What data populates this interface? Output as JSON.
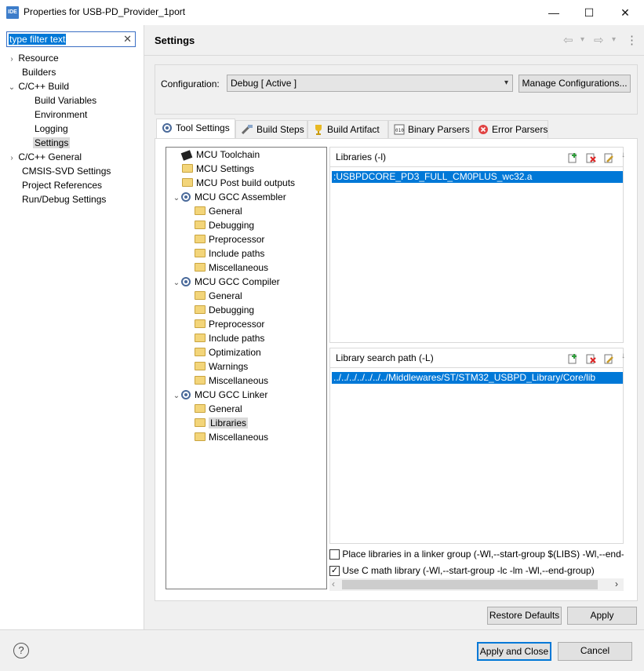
{
  "window": {
    "app_icon_text": "IDE",
    "title": "Properties for USB-PD_Provider_1port",
    "minimize": "—",
    "maximize": "☐",
    "close": "✕"
  },
  "filter": {
    "value": "type filter text",
    "clear": "✕"
  },
  "nav": {
    "items": [
      {
        "label": "Resource",
        "chevron": "›"
      },
      {
        "label": "Builders"
      },
      {
        "label": "C/C++ Build",
        "chevron": "⌄"
      },
      {
        "label": "Build Variables"
      },
      {
        "label": "Environment"
      },
      {
        "label": "Logging"
      },
      {
        "label": "Settings"
      },
      {
        "label": "C/C++ General",
        "chevron": "›"
      },
      {
        "label": "CMSIS-SVD Settings"
      },
      {
        "label": "Project References"
      },
      {
        "label": "Run/Debug Settings"
      }
    ]
  },
  "header": {
    "title": "Settings",
    "back": "⇦",
    "forward": "⇨",
    "dropdown": "▾",
    "menu": "⋮"
  },
  "config": {
    "label": "Configuration:",
    "value": "Debug  [ Active ]",
    "manage_button": "Manage Configurations..."
  },
  "tabs": [
    {
      "label": "Tool Settings",
      "icon": "tool-settings-icon"
    },
    {
      "label": "Build Steps",
      "icon": "build-steps-icon"
    },
    {
      "label": "Build Artifact",
      "icon": "trophy-icon"
    },
    {
      "label": "Binary Parsers",
      "icon": "binary-icon"
    },
    {
      "label": "Error Parsers",
      "icon": "error-icon"
    }
  ],
  "tree": {
    "items": [
      {
        "label": "MCU Toolchain"
      },
      {
        "label": "MCU Settings"
      },
      {
        "label": "MCU Post build outputs"
      },
      {
        "label": "MCU GCC Assembler",
        "chevron": "⌄"
      },
      {
        "label": "General"
      },
      {
        "label": "Debugging"
      },
      {
        "label": "Preprocessor"
      },
      {
        "label": "Include paths"
      },
      {
        "label": "Miscellaneous"
      },
      {
        "label": "MCU GCC Compiler",
        "chevron": "⌄"
      },
      {
        "label": "General"
      },
      {
        "label": "Debugging"
      },
      {
        "label": "Preprocessor"
      },
      {
        "label": "Include paths"
      },
      {
        "label": "Optimization"
      },
      {
        "label": "Warnings"
      },
      {
        "label": "Miscellaneous"
      },
      {
        "label": "MCU GCC Linker",
        "chevron": "⌄"
      },
      {
        "label": "General"
      },
      {
        "label": "Libraries"
      },
      {
        "label": "Miscellaneous"
      }
    ]
  },
  "libraries": {
    "title": "Libraries (-l)",
    "items": [
      ":USBPDCORE_PD3_FULL_CM0PLUS_wc32.a"
    ]
  },
  "search_path": {
    "title": "Library search path (-L)",
    "items": [
      "../../../../../../../Middlewares/ST/STM32_USBPD_Library/Core/lib"
    ]
  },
  "options": {
    "group_label": "Place libraries in a linker group (-Wl,--start-group $(LIBS) -Wl,--end-",
    "group_checked": false,
    "math_label": "Use C math library (-Wl,--start-group -lc -lm -Wl,--end-group)",
    "math_checked": true,
    "scroll_left": "‹",
    "scroll_right": "›"
  },
  "buttons": {
    "restore": "Restore Defaults",
    "apply": "Apply",
    "apply_close": "Apply and Close",
    "cancel": "Cancel",
    "help": "?"
  }
}
